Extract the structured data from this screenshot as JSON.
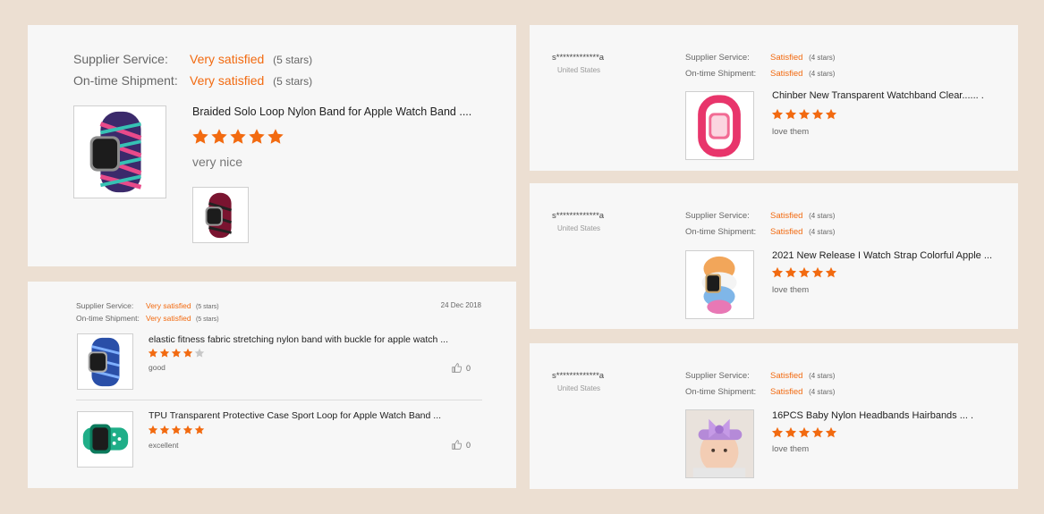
{
  "cards": {
    "large": {
      "supplier_label": "Supplier Service:",
      "supplier_value": "Very satisfied",
      "supplier_stars": "(5 stars)",
      "shipment_label": "On-time Shipment:",
      "shipment_value": "Very satisfied",
      "shipment_stars": "(5 stars)",
      "product_title": "Braided Solo Loop Nylon Band for Apple Watch Band ....",
      "rating": 5,
      "comment": "very nice"
    },
    "multi": {
      "supplier_label": "Supplier Service:",
      "supplier_value": "Very satisfied",
      "supplier_stars": "(5 stars)",
      "shipment_label": "On-time Shipment:",
      "shipment_value": "Very satisfied",
      "shipment_stars": "(5 stars)",
      "date": "24 Dec 2018",
      "items": [
        {
          "title": "elastic fitness fabric stretching nylon band with buckle for apple watch ...",
          "rating": 4,
          "comment": "good",
          "likes": "0"
        },
        {
          "title": "TPU Transparent Protective Case Sport Loop for Apple Watch Band  ...",
          "rating": 5,
          "comment": "excellent",
          "likes": "0"
        }
      ]
    },
    "right": [
      {
        "user": "s*************a",
        "country": "United States",
        "supplier_label": "Supplier Service:",
        "supplier_value": "Satisfied",
        "supplier_stars": "(4 stars)",
        "shipment_label": "On-time Shipment:",
        "shipment_value": "Satisfied",
        "shipment_stars": "(4 stars)",
        "product_title": "Chinber New Transparent Watchband Clear...... .",
        "rating": 5,
        "comment": "love them"
      },
      {
        "user": "s*************a",
        "country": "United States",
        "supplier_label": "Supplier Service:",
        "supplier_value": "Satisfied",
        "supplier_stars": "(4 stars)",
        "shipment_label": "On-time Shipment:",
        "shipment_value": "Satisfied",
        "shipment_stars": "(4 stars)",
        "product_title": "2021 New Release I Watch Strap Colorful Apple ...",
        "rating": 5,
        "comment": "love them"
      },
      {
        "user": "s*************a",
        "country": "United States",
        "supplier_label": "Supplier Service:",
        "supplier_value": "Satisfied",
        "supplier_stars": "(4 stars)",
        "shipment_label": "On-time Shipment:",
        "shipment_value": "Satisfied",
        "shipment_stars": "(4 stars)",
        "product_title": "16PCS Baby Nylon Headbands Hairbands ...   .",
        "rating": 5,
        "comment": "love them"
      }
    ]
  },
  "icons": {
    "star": "star-icon",
    "like": "thumbs-up-icon"
  },
  "colors": {
    "accent": "#f26a10",
    "background": "#ecdfd2",
    "card": "#f7f7f7"
  }
}
